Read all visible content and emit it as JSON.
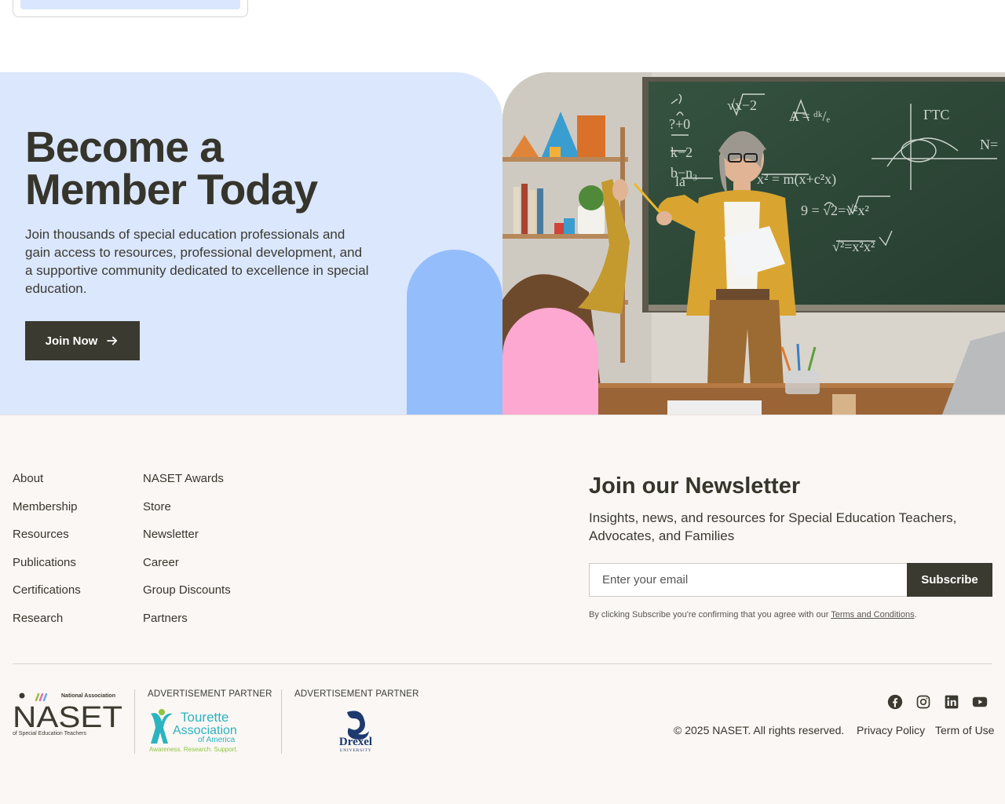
{
  "hero": {
    "title": "Become a Member Today",
    "description": "Join thousands of special education professionals and gain access to resources, professional development, and a supportive community dedicated to excellence in special education.",
    "cta_label": "Join Now",
    "image_alt": "Teacher at chalkboard with student raising hand"
  },
  "footer": {
    "links_col1": [
      "About",
      "Membership",
      "Resources",
      "Publications",
      "Certifications",
      "Research"
    ],
    "links_col2": [
      "NASET Awards",
      "Store",
      "Newsletter",
      "Career",
      "Group Discounts",
      "Partners"
    ],
    "newsletter": {
      "title": "Join our Newsletter",
      "subtitle": "Insights, news, and resources for Special Education Teachers, Advocates, and Families",
      "email_placeholder": "Enter your email",
      "subscribe_label": "Subscribe",
      "disclaimer_prefix": "By clicking Subscribe you're confirming that you agree with our ",
      "terms_label": "Terms and Conditions",
      "disclaimer_suffix": "."
    },
    "logos": {
      "naset_small": "National Association",
      "naset_main": "NASET",
      "naset_tagline": "of Special Education Teachers",
      "partner_label_1": "ADVERTISEMENT PARTNER",
      "partner_label_2": "ADVERTISEMENT PARTNER",
      "tourette_line1": "Tourette",
      "tourette_line2": "Association",
      "tourette_line3": "of America",
      "tourette_tagline": "Awareness. Research. Support.",
      "drexel_name": "Drexel",
      "drexel_sub": "UNIVERSITY"
    },
    "social_icons": [
      "facebook-icon",
      "instagram-icon",
      "linkedin-icon",
      "youtube-icon"
    ],
    "copyright": "© 2025 NASET. All rights reserved.",
    "privacy_label": "Privacy Policy",
    "terms_label": "Term of Use"
  },
  "colors": {
    "hero_bg": "#dbe7fd",
    "dark": "#3b3a30",
    "blue_arch": "#94bdfb",
    "pink_arch": "#fca8d1",
    "footer_bg": "#fbf7f4"
  }
}
